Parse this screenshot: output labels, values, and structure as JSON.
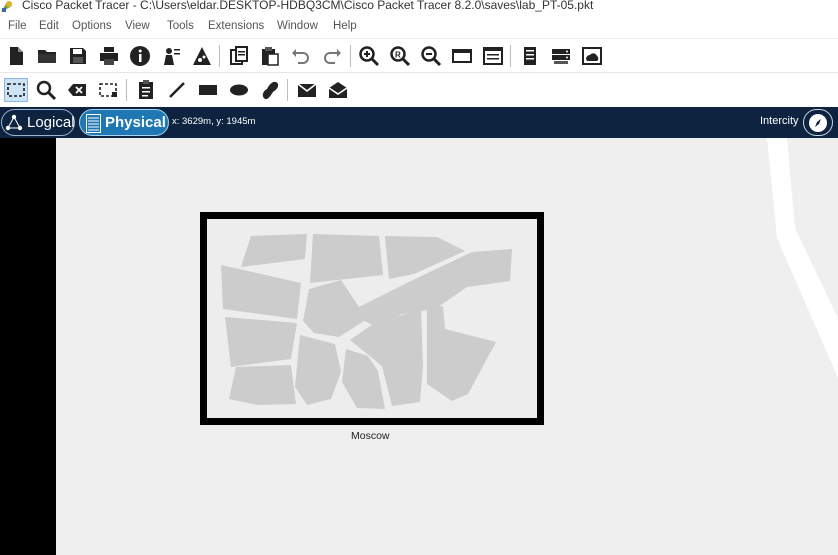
{
  "window": {
    "title": "Cisco Packet Tracer - C:\\Users\\eldar.DESKTOP-HDBQ3CM\\Cisco Packet Tracer 8.2.0\\saves\\lab_PT-05.pkt"
  },
  "menu": {
    "file": "File",
    "edit": "Edit",
    "options": "Options",
    "view": "View",
    "tools": "Tools",
    "extensions": "Extensions",
    "window": "Window",
    "help": "Help"
  },
  "toolbar_main": {
    "icons": [
      "new-file-icon",
      "open-folder-icon",
      "save-icon",
      "print-icon",
      "info-icon",
      "activity-wizard-icon",
      "palette-icon",
      "copy-icon",
      "paste-icon",
      "undo-icon",
      "redo-icon",
      "zoom-in-icon",
      "zoom-reset-icon",
      "zoom-out-icon",
      "drawing-palette-icon",
      "custom-devices-icon",
      "viewport-icon",
      "device-rack-icon",
      "cluster-icon"
    ]
  },
  "toolbar_common": {
    "icons": [
      "select-icon",
      "inspect-icon",
      "delete-icon",
      "resize-shape-icon",
      "place-note-icon",
      "draw-line-icon",
      "draw-rectangle-icon",
      "draw-ellipse-icon",
      "freeform-icon",
      "add-simple-pdu-icon",
      "add-complex-pdu-icon"
    ]
  },
  "nav": {
    "logical": "Logical",
    "physical": "Physical",
    "coordinates": "x: 3629m, y: 1945m",
    "intercity": "Intercity"
  },
  "canvas": {
    "city_label": "Moscow"
  },
  "colors": {
    "nav_bar": "#0d2340",
    "active_tab": "#1f77b4",
    "canvas_bg": "#efefef"
  }
}
